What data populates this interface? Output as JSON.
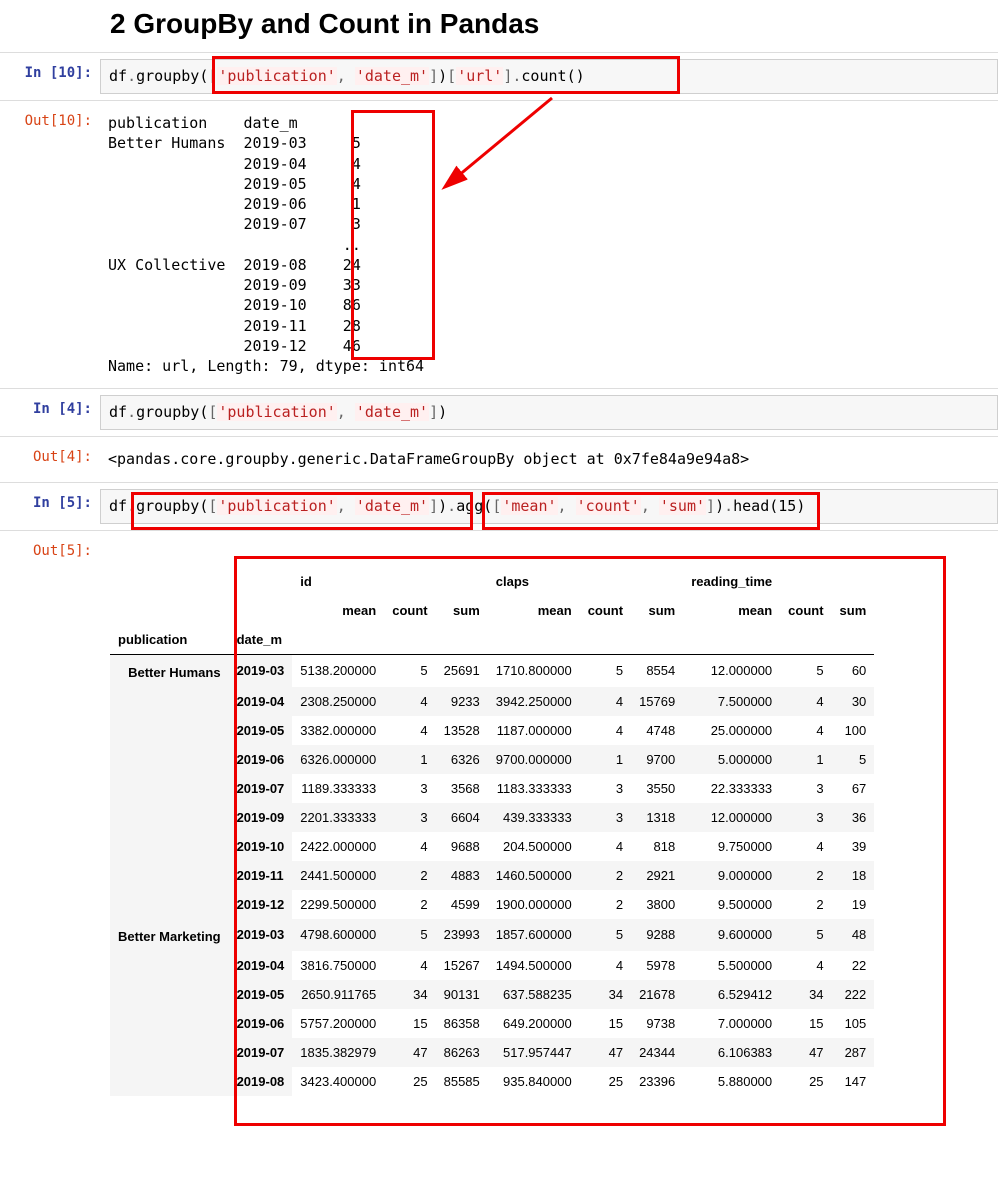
{
  "heading": "2  GroupBy and Count in Pandas",
  "cells": {
    "c1": {
      "prompt_in": "In [10]:",
      "prompt_out": "Out[10]:",
      "code_tokens": [
        [
          "c-var",
          "df"
        ],
        [
          "c-op",
          "."
        ],
        [
          "c-meth",
          "groupby"
        ],
        [
          "c-par",
          "("
        ],
        [
          "c-punc",
          "["
        ],
        [
          "c-str",
          "'publication'"
        ],
        [
          "c-punc",
          ", "
        ],
        [
          "c-str",
          "'date_m'"
        ],
        [
          "c-punc",
          "]"
        ],
        [
          "c-par",
          ")"
        ],
        [
          "c-punc",
          "["
        ],
        [
          "c-str",
          "'url'"
        ],
        [
          "c-punc",
          "]"
        ],
        [
          "c-op",
          "."
        ],
        [
          "c-meth",
          "count"
        ],
        [
          "c-par",
          "()"
        ]
      ],
      "output_lines": [
        "publication    date_m ",
        "Better Humans  2019-03     5",
        "               2019-04     4",
        "               2019-05     4",
        "               2019-06     1",
        "               2019-07     3",
        "                          ..",
        "UX Collective  2019-08    24",
        "               2019-09    33",
        "               2019-10    86",
        "               2019-11    28",
        "               2019-12    46",
        "Name: url, Length: 79, dtype: int64"
      ]
    },
    "c2": {
      "prompt_in": "In [4]:",
      "prompt_out": "Out[4]:",
      "code_tokens": [
        [
          "c-var",
          "df"
        ],
        [
          "c-op",
          "."
        ],
        [
          "c-meth",
          "groupby"
        ],
        [
          "c-par",
          "("
        ],
        [
          "c-punc",
          "["
        ],
        [
          "c-str",
          "'publication'"
        ],
        [
          "c-punc",
          ", "
        ],
        [
          "c-str",
          "'date_m'"
        ],
        [
          "c-punc",
          "]"
        ],
        [
          "c-par",
          ")"
        ]
      ],
      "output": "<pandas.core.groupby.generic.DataFrameGroupBy object at 0x7fe84a9e94a8>"
    },
    "c3": {
      "prompt_in": "In [5]:",
      "prompt_out": "Out[5]:",
      "code_tokens": [
        [
          "c-var",
          "df"
        ],
        [
          "c-op",
          "."
        ],
        [
          "c-meth",
          "groupby"
        ],
        [
          "c-par",
          "("
        ],
        [
          "c-punc",
          "["
        ],
        [
          "c-str",
          "'publication'"
        ],
        [
          "c-punc",
          ", "
        ],
        [
          "c-str",
          "'date_m'"
        ],
        [
          "c-punc",
          "]"
        ],
        [
          "c-par",
          ")"
        ],
        [
          "c-op",
          "."
        ],
        [
          "c-meth",
          "agg"
        ],
        [
          "c-par",
          "("
        ],
        [
          "c-punc",
          "["
        ],
        [
          "c-str",
          "'mean'"
        ],
        [
          "c-punc",
          ", "
        ],
        [
          "c-str",
          "'count'"
        ],
        [
          "c-punc",
          ", "
        ],
        [
          "c-str",
          "'sum'"
        ],
        [
          "c-punc",
          "]"
        ],
        [
          "c-par",
          ")"
        ],
        [
          "c-op",
          "."
        ],
        [
          "c-meth",
          "head"
        ],
        [
          "c-par",
          "("
        ],
        [
          "c-var",
          "15"
        ],
        [
          "c-par",
          ")"
        ]
      ]
    }
  },
  "table": {
    "top_cols": [
      "id",
      "claps",
      "reading_time"
    ],
    "sub_cols": [
      "mean",
      "count",
      "sum"
    ],
    "index_names": [
      "publication",
      "date_m"
    ],
    "groups": [
      {
        "name": "Better Humans",
        "rows": [
          {
            "date": "2019-03",
            "id_mean": "5138.200000",
            "id_count": "5",
            "id_sum": "25691",
            "claps_mean": "1710.800000",
            "claps_count": "5",
            "claps_sum": "8554",
            "rt_mean": "12.000000",
            "rt_count": "5",
            "rt_sum": "60"
          },
          {
            "date": "2019-04",
            "id_mean": "2308.250000",
            "id_count": "4",
            "id_sum": "9233",
            "claps_mean": "3942.250000",
            "claps_count": "4",
            "claps_sum": "15769",
            "rt_mean": "7.500000",
            "rt_count": "4",
            "rt_sum": "30"
          },
          {
            "date": "2019-05",
            "id_mean": "3382.000000",
            "id_count": "4",
            "id_sum": "13528",
            "claps_mean": "1187.000000",
            "claps_count": "4",
            "claps_sum": "4748",
            "rt_mean": "25.000000",
            "rt_count": "4",
            "rt_sum": "100"
          },
          {
            "date": "2019-06",
            "id_mean": "6326.000000",
            "id_count": "1",
            "id_sum": "6326",
            "claps_mean": "9700.000000",
            "claps_count": "1",
            "claps_sum": "9700",
            "rt_mean": "5.000000",
            "rt_count": "1",
            "rt_sum": "5"
          },
          {
            "date": "2019-07",
            "id_mean": "1189.333333",
            "id_count": "3",
            "id_sum": "3568",
            "claps_mean": "1183.333333",
            "claps_count": "3",
            "claps_sum": "3550",
            "rt_mean": "22.333333",
            "rt_count": "3",
            "rt_sum": "67"
          },
          {
            "date": "2019-09",
            "id_mean": "2201.333333",
            "id_count": "3",
            "id_sum": "6604",
            "claps_mean": "439.333333",
            "claps_count": "3",
            "claps_sum": "1318",
            "rt_mean": "12.000000",
            "rt_count": "3",
            "rt_sum": "36"
          },
          {
            "date": "2019-10",
            "id_mean": "2422.000000",
            "id_count": "4",
            "id_sum": "9688",
            "claps_mean": "204.500000",
            "claps_count": "4",
            "claps_sum": "818",
            "rt_mean": "9.750000",
            "rt_count": "4",
            "rt_sum": "39"
          },
          {
            "date": "2019-11",
            "id_mean": "2441.500000",
            "id_count": "2",
            "id_sum": "4883",
            "claps_mean": "1460.500000",
            "claps_count": "2",
            "claps_sum": "2921",
            "rt_mean": "9.000000",
            "rt_count": "2",
            "rt_sum": "18"
          },
          {
            "date": "2019-12",
            "id_mean": "2299.500000",
            "id_count": "2",
            "id_sum": "4599",
            "claps_mean": "1900.000000",
            "claps_count": "2",
            "claps_sum": "3800",
            "rt_mean": "9.500000",
            "rt_count": "2",
            "rt_sum": "19"
          }
        ]
      },
      {
        "name": "Better Marketing",
        "rows": [
          {
            "date": "2019-03",
            "id_mean": "4798.600000",
            "id_count": "5",
            "id_sum": "23993",
            "claps_mean": "1857.600000",
            "claps_count": "5",
            "claps_sum": "9288",
            "rt_mean": "9.600000",
            "rt_count": "5",
            "rt_sum": "48"
          },
          {
            "date": "2019-04",
            "id_mean": "3816.750000",
            "id_count": "4",
            "id_sum": "15267",
            "claps_mean": "1494.500000",
            "claps_count": "4",
            "claps_sum": "5978",
            "rt_mean": "5.500000",
            "rt_count": "4",
            "rt_sum": "22"
          },
          {
            "date": "2019-05",
            "id_mean": "2650.911765",
            "id_count": "34",
            "id_sum": "90131",
            "claps_mean": "637.588235",
            "claps_count": "34",
            "claps_sum": "21678",
            "rt_mean": "6.529412",
            "rt_count": "34",
            "rt_sum": "222"
          },
          {
            "date": "2019-06",
            "id_mean": "5757.200000",
            "id_count": "15",
            "id_sum": "86358",
            "claps_mean": "649.200000",
            "claps_count": "15",
            "claps_sum": "9738",
            "rt_mean": "7.000000",
            "rt_count": "15",
            "rt_sum": "105"
          },
          {
            "date": "2019-07",
            "id_mean": "1835.382979",
            "id_count": "47",
            "id_sum": "86263",
            "claps_mean": "517.957447",
            "claps_count": "47",
            "claps_sum": "24344",
            "rt_mean": "6.106383",
            "rt_count": "47",
            "rt_sum": "287"
          },
          {
            "date": "2019-08",
            "id_mean": "3423.400000",
            "id_count": "25",
            "id_sum": "85585",
            "claps_mean": "935.840000",
            "claps_count": "25",
            "claps_sum": "23396",
            "rt_mean": "5.880000",
            "rt_count": "25",
            "rt_sum": "147"
          }
        ]
      }
    ]
  },
  "annotations": {
    "num_red_boxes": 5,
    "arrow": "points from code fragment to counts column"
  }
}
